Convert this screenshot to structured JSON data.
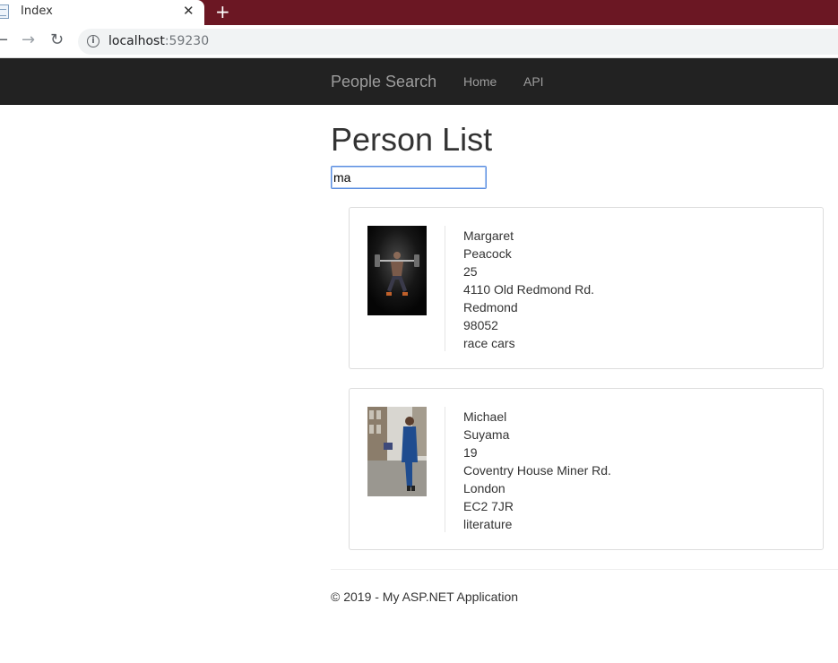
{
  "browser": {
    "tab_title": "Index",
    "tab_close": "✕",
    "new_tab": "+",
    "url_host": "localhost",
    "url_port": ":59230",
    "icons": [
      "page-favicon-icon",
      "back-icon",
      "forward-icon",
      "reload-icon",
      "info-icon"
    ]
  },
  "navbar": {
    "brand": "People Search",
    "links": [
      "Home",
      "API"
    ]
  },
  "main": {
    "title": "Person List",
    "search_value": "ma",
    "people": [
      {
        "first_name": "Margaret",
        "last_name": "Peacock",
        "age": "25",
        "address": "4110 Old Redmond Rd.",
        "city": "Redmond",
        "postal_code": "98052",
        "interests": "race cars"
      },
      {
        "first_name": "Michael",
        "last_name": "Suyama",
        "age": "19",
        "address": "Coventry House Miner Rd.",
        "city": "London",
        "postal_code": "EC2 7JR",
        "interests": "literature"
      }
    ]
  },
  "footer": {
    "text": "© 2019 - My ASP.NET Application"
  },
  "colors": {
    "tabbar": "#6b1723",
    "navbar": "#222222",
    "navtext": "#9d9d9d",
    "input_focus": "#5a8de0"
  }
}
